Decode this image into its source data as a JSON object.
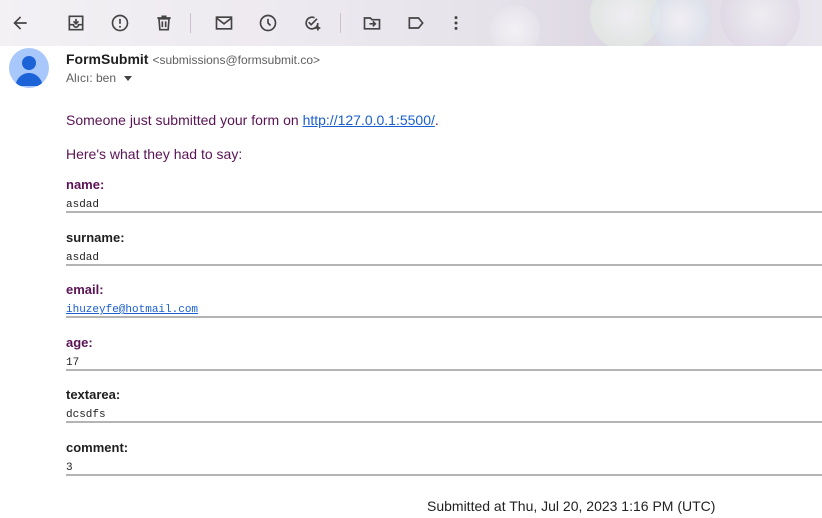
{
  "toolbar": {
    "items": [
      {
        "name": "back",
        "icon": "arrow-left-icon"
      },
      {
        "name": "archive",
        "icon": "archive-icon"
      },
      {
        "name": "report-spam",
        "icon": "report-spam-icon"
      },
      {
        "name": "delete",
        "icon": "trash-icon"
      },
      {
        "name": "mark-unread",
        "icon": "mail-icon"
      },
      {
        "name": "snooze",
        "icon": "clock-icon"
      },
      {
        "name": "add-task",
        "icon": "add-task-icon"
      },
      {
        "name": "move-to",
        "icon": "folder-move-icon"
      },
      {
        "name": "labels",
        "icon": "label-icon"
      },
      {
        "name": "more",
        "icon": "more-vert-icon"
      }
    ]
  },
  "email": {
    "sender_name": "FormSubmit",
    "sender_address": "<submissions@formsubmit.co>",
    "recipient_label": "Alıcı: ben",
    "intro_text": "Someone just submitted your form on ",
    "intro_link": "http://127.0.0.1:5500/",
    "intro_end": ".",
    "subheading": "Here's what they had to say:",
    "fields": [
      {
        "label": "name:",
        "value": "asdad",
        "label_color": "#5a1355",
        "is_link": false
      },
      {
        "label": "surname:",
        "value": "asdad",
        "label_color": "#1f1f1f",
        "is_link": false
      },
      {
        "label": "email:",
        "value": "ihuzeyfe@hotmail.com",
        "label_color": "#5a1355",
        "is_link": true
      },
      {
        "label": "age:",
        "value": "17",
        "label_color": "#5a1355",
        "is_link": false
      },
      {
        "label": "textarea:",
        "value": "dcsdfs",
        "label_color": "#1f1f1f",
        "is_link": false
      },
      {
        "label": "comment:",
        "value": "3",
        "label_color": "#1f1f1f",
        "is_link": false
      }
    ],
    "footer": "Submitted at Thu, Jul 20, 2023 1:16 PM (UTC)"
  }
}
